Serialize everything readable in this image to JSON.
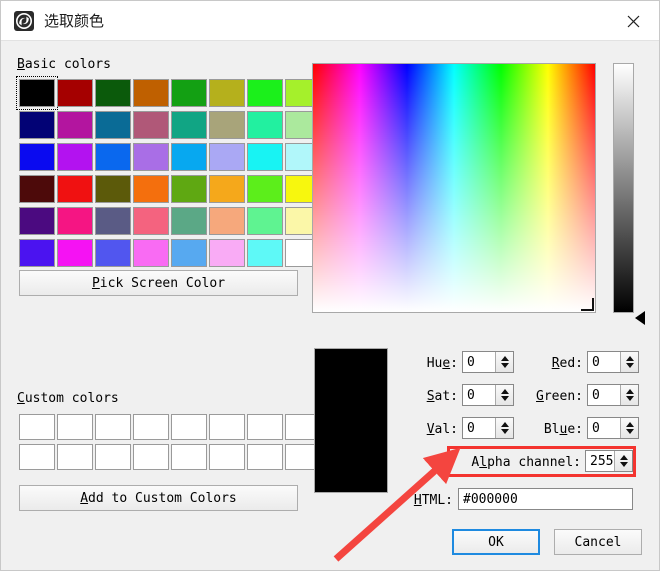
{
  "window": {
    "title": "选取颜色",
    "icon": "shutter-icon",
    "close_label": "✕"
  },
  "basic_colors": {
    "label": "Basic colors",
    "mnemonic": "B",
    "selected_index": 0,
    "swatches": [
      "#000000",
      "#a50000",
      "#0b5a0b",
      "#bf6000",
      "#13a013",
      "#b5b01c",
      "#1bf01b",
      "#a5f02b",
      "#020275",
      "#b3159f",
      "#0a6b96",
      "#b05878",
      "#11a584",
      "#a8a47a",
      "#22f0a0",
      "#abe99d",
      "#0a0af0",
      "#b312f0",
      "#0a68ee",
      "#a96ee6",
      "#07a8f0",
      "#aaa8f4",
      "#18f3f3",
      "#b1f7fa",
      "#4d0a0a",
      "#f01111",
      "#5c5a0a",
      "#f46f0d",
      "#5fa812",
      "#f5a81b",
      "#5cee1b",
      "#f7f70e",
      "#4b0a80",
      "#f51583",
      "#5a5b85",
      "#f4637f",
      "#5ba886",
      "#f6a87c",
      "#5ff391",
      "#fbf7a8",
      "#4b13f0",
      "#f512f3",
      "#5156ef",
      "#f96bf3",
      "#57a9f0",
      "#f9abf5",
      "#5ef9f7",
      "#ffffff"
    ]
  },
  "pick_screen": {
    "label": "Pick Screen Color",
    "mnemonic": "P"
  },
  "custom_colors": {
    "label": "Custom colors",
    "mnemonic": "C",
    "swatches": [
      "#ffffff",
      "#ffffff",
      "#ffffff",
      "#ffffff",
      "#ffffff",
      "#ffffff",
      "#ffffff",
      "#ffffff",
      "#ffffff",
      "#ffffff",
      "#ffffff",
      "#ffffff",
      "#ffffff",
      "#ffffff",
      "#ffffff",
      "#ffffff"
    ]
  },
  "add_custom": {
    "label": "Add to Custom Colors",
    "mnemonic": "A"
  },
  "preview": {
    "color": "#000000"
  },
  "fields": {
    "hue": {
      "label_pre": "Hu",
      "mnemonic": "e",
      "label_post": ":",
      "value": "0"
    },
    "sat": {
      "label_pre": "",
      "mnemonic": "S",
      "label_post": "at:",
      "value": "0"
    },
    "val": {
      "label_pre": "",
      "mnemonic": "V",
      "label_post": "al:",
      "value": "0"
    },
    "red": {
      "label_pre": "",
      "mnemonic": "R",
      "label_post": "ed:",
      "value": "0"
    },
    "green": {
      "label_pre": "",
      "mnemonic": "G",
      "label_post": "reen:",
      "value": "0"
    },
    "blue": {
      "label_pre": "Bl",
      "mnemonic": "u",
      "label_post": "e:",
      "value": "0"
    },
    "alpha": {
      "label_pre": "A",
      "mnemonic": "l",
      "label_post": "pha channel:",
      "value": "255"
    },
    "html": {
      "label_pre": "",
      "mnemonic": "H",
      "label_post": "TML:",
      "value": "#000000"
    }
  },
  "buttons": {
    "ok": "OK",
    "cancel": "Cancel"
  },
  "annotation": {
    "highlight_color": "#f4342f",
    "arrow_color": "#f4453f",
    "target": "alpha-channel-field"
  }
}
